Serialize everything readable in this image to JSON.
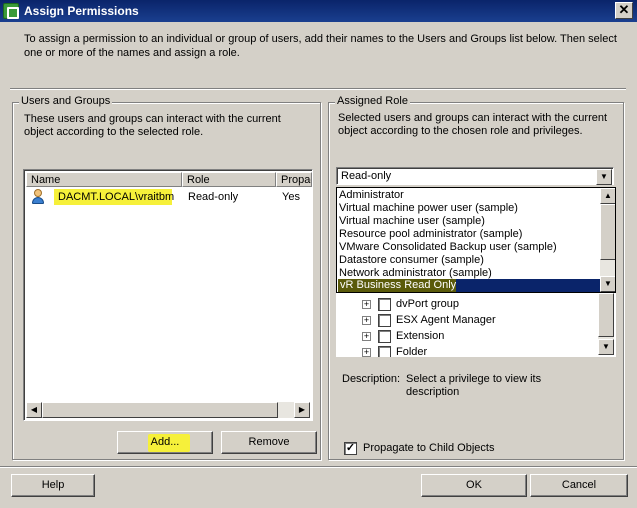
{
  "window": {
    "title": "Assign Permissions",
    "close_glyph": "✕"
  },
  "intro_text": "To assign a permission to an individual or group of users, add their names to the Users and Groups list below. Then select one or more of the names and assign a role.",
  "users_groups": {
    "title": "Users and Groups",
    "description": "These users and groups can interact with the current object according to the selected role.",
    "columns": [
      "Name",
      "Role",
      "Propagate"
    ],
    "rows": [
      {
        "name": "DACMT.LOCAL\\vraitbm",
        "role": "Read-only",
        "propagate": "Yes"
      }
    ],
    "add_label": "Add...",
    "remove_label": "Remove"
  },
  "assigned_role": {
    "title": "Assigned Role",
    "description": "Selected users and groups can interact with the current object according to the chosen role and privileges.",
    "selected_role": "Read-only",
    "dropdown_options": [
      "Administrator",
      "Virtual machine power user (sample)",
      "Virtual machine user (sample)",
      "Resource pool administrator (sample)",
      "VMware Consolidated Backup user (sample)",
      "Datastore consumer (sample)",
      "Network administrator (sample)"
    ],
    "highlighted_option": "vR Business Read Only",
    "tree_items": [
      "dvPort group",
      "ESX Agent Manager",
      "Extension",
      "Folder"
    ],
    "description_label": "Description:",
    "description_value": "Select a privilege to view its description",
    "propagate_label": "Propagate to Child Objects",
    "propagate_checked": true
  },
  "footer": {
    "help_label": "Help",
    "ok_label": "OK",
    "cancel_label": "Cancel"
  },
  "icons": {
    "scroll_left": "◀",
    "scroll_right": "▶",
    "scroll_up": "▲",
    "scroll_down": "▼",
    "check_mark": "✓",
    "expand": "+"
  },
  "colors": {
    "highlight": "#f6f03a",
    "selection": "#0a246a",
    "titlebar": "#0a246a"
  }
}
